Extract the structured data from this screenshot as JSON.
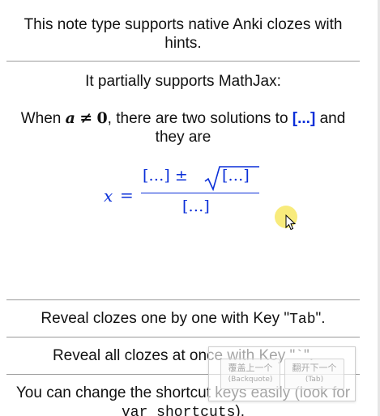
{
  "intro": {
    "line": "This note type supports native Anki clozes with hints."
  },
  "mathjax": {
    "heading": "It partially supports MathJax:",
    "sentence_before": "When",
    "var_a": "a",
    "neq": "≠",
    "zero": "0",
    "sentence_mid": ", there are two solutions to",
    "cloze": "[...]",
    "sentence_after": "and they are",
    "formula": {
      "lhs": "x",
      "eq": "=",
      "numerator_left": "[…] ±",
      "radicand": "[…]",
      "denominator": "[…]"
    }
  },
  "tab_line": {
    "before": "Reveal clozes one by one with Key \"",
    "key": "Tab",
    "after": "\"."
  },
  "backquote_line": {
    "before": "Reveal all clozes at once with Key \"",
    "key": "`",
    "after": "\"."
  },
  "shortcut_line": {
    "before": "You can change the shortcut keys easily (look for",
    "code": "var shortcuts",
    "after": ")."
  },
  "tooltip": {
    "prev_label": "覆盖上一个",
    "prev_key": "(Backquote)",
    "next_label": "翻开下一个",
    "next_key": "(Tab)"
  },
  "colors": {
    "cloze": "#0a2fd8",
    "cursor_highlight": "#f5e450"
  }
}
